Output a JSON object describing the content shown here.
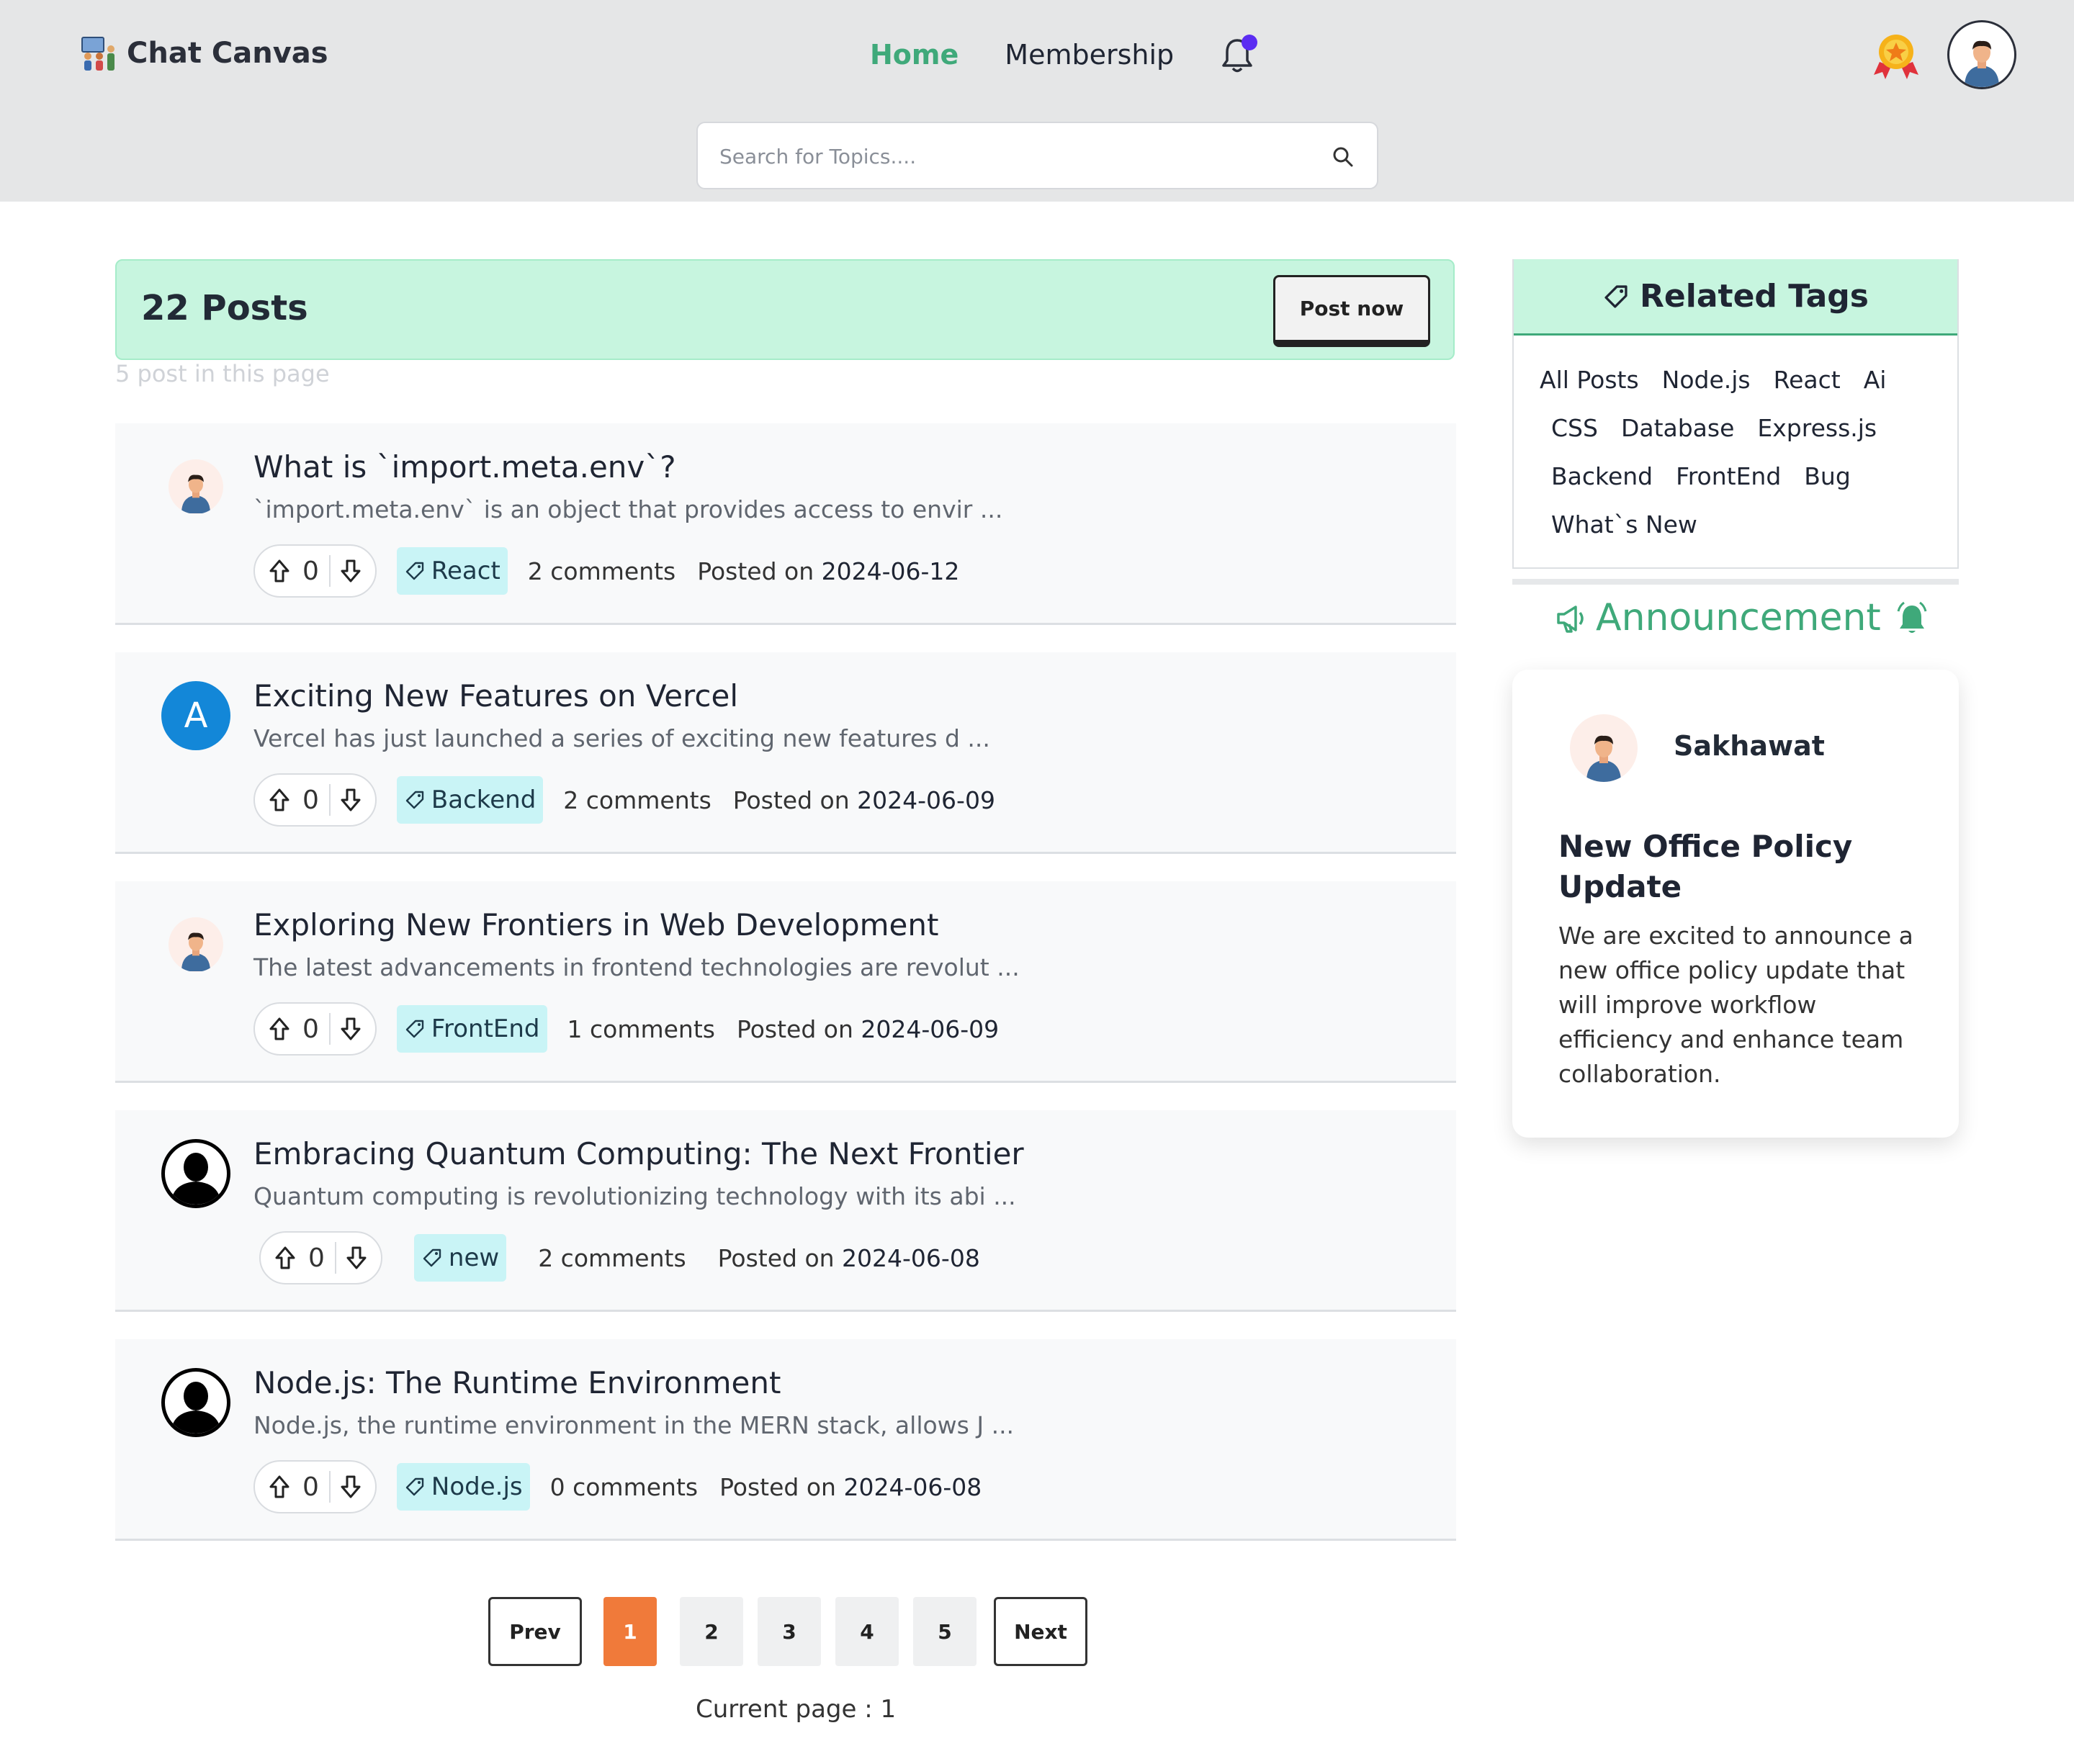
{
  "brand": {
    "name": "Chat Canvas",
    "icon": "team-meeting-icon"
  },
  "nav": {
    "home": "Home",
    "membership": "Membership",
    "notification_icon": "bell-icon",
    "badge_color": "#5b2cf2"
  },
  "search": {
    "placeholder": "Search for Topics....",
    "icon": "search-icon"
  },
  "posts_header": {
    "count_label": "22 Posts",
    "post_now": "Post now",
    "subtitle": "5 post in this page"
  },
  "posts": [
    {
      "title": "What is `import.meta.env`?",
      "excerpt": "`import.meta.env` is an object that provides access to envir ...",
      "votes": "0",
      "tag": "React",
      "comments": "2 comments",
      "posted_label": "Posted on",
      "date": "2024-06-12",
      "avatar": "man-avatar"
    },
    {
      "title": "Exciting New Features on Vercel",
      "excerpt": "Vercel has just launched a series of exciting new features d ...",
      "votes": "0",
      "tag": "Backend",
      "comments": "2 comments",
      "posted_label": "Posted on",
      "date": "2024-06-09",
      "avatar": "letter-avatar",
      "avatar_letter": "A"
    },
    {
      "title": "Exploring New Frontiers in Web Development",
      "excerpt": "The latest advancements in frontend technologies are revolut ...",
      "votes": "0",
      "tag": "FrontEnd",
      "comments": "1 comments",
      "posted_label": "Posted on",
      "date": "2024-06-09",
      "avatar": "man-avatar"
    },
    {
      "title": "Embracing Quantum Computing: The Next Frontier",
      "excerpt": "Quantum computing is revolutionizing technology with its abi ...",
      "votes": "0",
      "tag": "new",
      "comments": "2 comments",
      "posted_label": "Posted on",
      "date": "2024-06-08",
      "avatar": "silhouette-avatar"
    },
    {
      "title": "Node.js: The Runtime Environment",
      "excerpt": "Node.js, the runtime environment in the MERN stack, allows J ...",
      "votes": "0",
      "tag": "Node.js",
      "comments": "0 comments",
      "posted_label": "Posted on",
      "date": "2024-06-08",
      "avatar": "silhouette-avatar"
    }
  ],
  "pagination": {
    "prev": "Prev",
    "pages": [
      "1",
      "2",
      "3",
      "4",
      "5"
    ],
    "active_page": "1",
    "next": "Next",
    "current_label": "Current page : 1"
  },
  "related_tags": {
    "title": "Related Tags",
    "tags": [
      "All Posts",
      "Node.js",
      "React",
      "Ai",
      "CSS",
      "Database",
      "Express.js",
      "Backend",
      "FrontEnd",
      "Bug",
      "What`s New"
    ]
  },
  "announcement": {
    "heading": "Announcement",
    "author": "Sakhawat",
    "title": "New Office Policy Update",
    "body": "We are excited to announce a new office policy update that will improve workflow efficiency and enhance team collaboration."
  },
  "colors": {
    "accent_green": "#3fa97a",
    "header_bg": "#e5e6e7",
    "mint": "#c7f5df",
    "tag_bg": "#c9f4f6",
    "active_page": "#f07a3a",
    "letter_avatar": "#1387d8"
  }
}
